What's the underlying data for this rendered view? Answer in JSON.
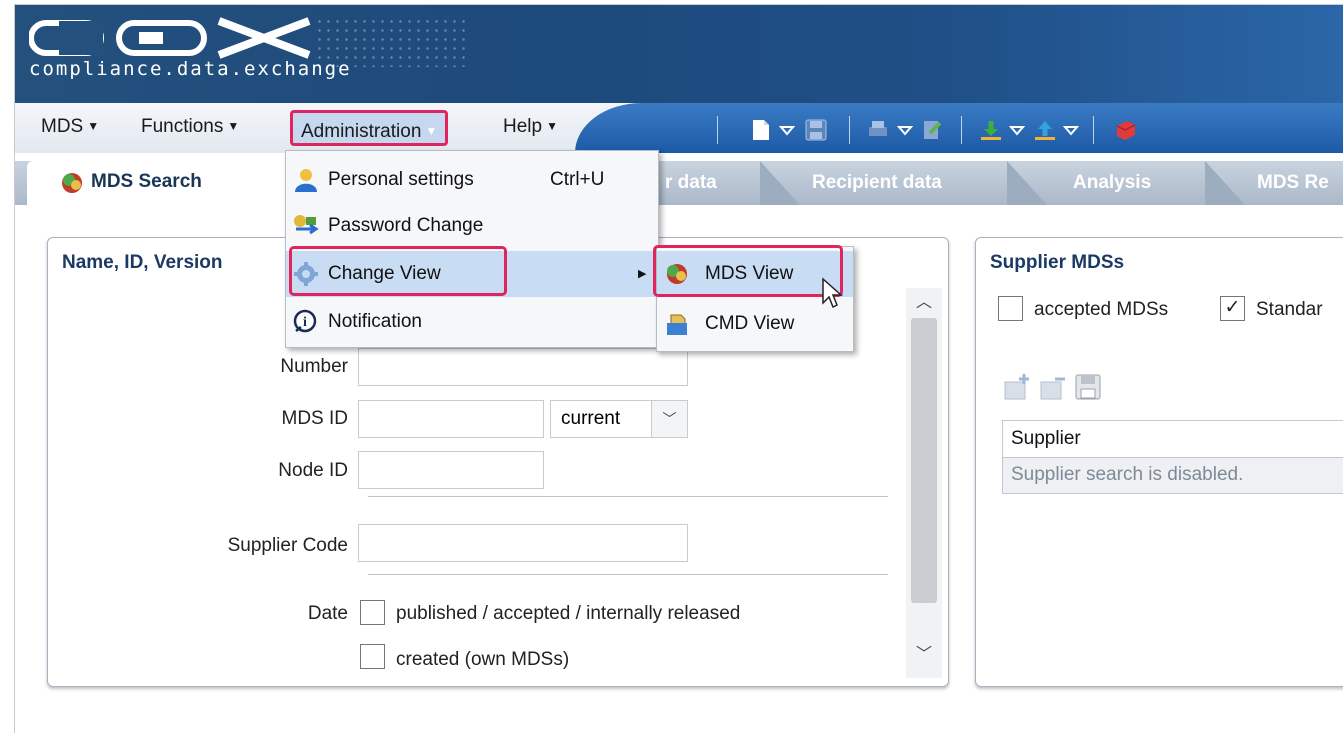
{
  "header": {
    "logo_text": "compliance.data.exchange"
  },
  "menubar": {
    "items": [
      {
        "label": "MDS"
      },
      {
        "label": "Functions"
      },
      {
        "label": "Administration"
      },
      {
        "label": "Help"
      }
    ]
  },
  "admin_menu": {
    "items": [
      {
        "label": "Personal settings",
        "shortcut": "Ctrl+U"
      },
      {
        "label": "Password Change"
      },
      {
        "label": "Change View"
      },
      {
        "label": "Notification"
      }
    ]
  },
  "change_view_submenu": {
    "items": [
      {
        "label": "MDS View"
      },
      {
        "label": "CMD View"
      }
    ]
  },
  "tabs": [
    {
      "label": "MDS Search"
    },
    {
      "label": "r data"
    },
    {
      "label": "Recipient data"
    },
    {
      "label": "Analysis"
    },
    {
      "label": "MDS Re"
    }
  ],
  "left_panel": {
    "title": "Name, ID, Version",
    "number_label": "Number",
    "mds_id_label": "MDS ID",
    "version_select": "current",
    "node_id_label": "Node ID",
    "supplier_code_label": "Supplier Code",
    "date_label": "Date",
    "date_options": [
      {
        "label": "published / accepted / internally released",
        "checked": false
      },
      {
        "label": "created (own MDSs)",
        "checked": false
      }
    ]
  },
  "right_panel": {
    "title": "Supplier MDSs",
    "options": [
      {
        "label": "accepted MDSs",
        "checked": false
      },
      {
        "label": "Standar",
        "checked": true
      }
    ],
    "table_header": "Supplier",
    "table_message": "Supplier search is disabled."
  },
  "colors": {
    "highlight": "#e0245e",
    "brand": "#1d4a7c"
  }
}
